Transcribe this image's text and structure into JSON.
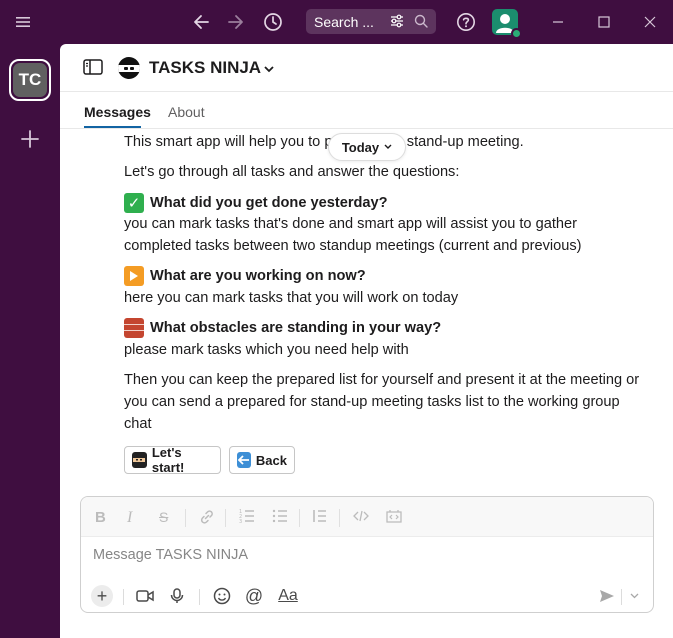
{
  "topbar": {
    "search_placeholder": "Search ..."
  },
  "workspace": {
    "initials": "TC"
  },
  "channel": {
    "title": "TASKS NINJA"
  },
  "tabs": [
    {
      "label": "Messages"
    },
    {
      "label": "About"
    }
  ],
  "date_divider": "Today",
  "message": {
    "line1_a": "This smart app will help you to p",
    "line1_b": "the stand-up meeting.",
    "line2": "Let's go through all tasks and answer the questions:",
    "q1": "What did you get done yesterday?",
    "q1_desc_1": "you can mark tasks that's done and smart app will assist you to gather",
    "q1_desc_2": "completed tasks between two standup meetings (current and previous)",
    "q2": "What are you working on now?",
    "q2_desc": "here you can mark tasks that you will work on today",
    "q3": "What obstacles are standing in your way?",
    "q3_desc": "please mark tasks which you need help with",
    "outro_1": "Then you can keep the prepared list for yourself and present it at the meeting or",
    "outro_2": "you can send a prepared for stand-up meeting tasks list to the working group",
    "outro_3": "chat"
  },
  "buttons": {
    "start": "Let's start!",
    "back": "Back"
  },
  "composer": {
    "placeholder": "Message TASKS NINJA",
    "aa_label": "Aa"
  },
  "colors": {
    "sidebar": "#3f0e40",
    "accent": "#1264a3",
    "presence": "#2bac76"
  }
}
